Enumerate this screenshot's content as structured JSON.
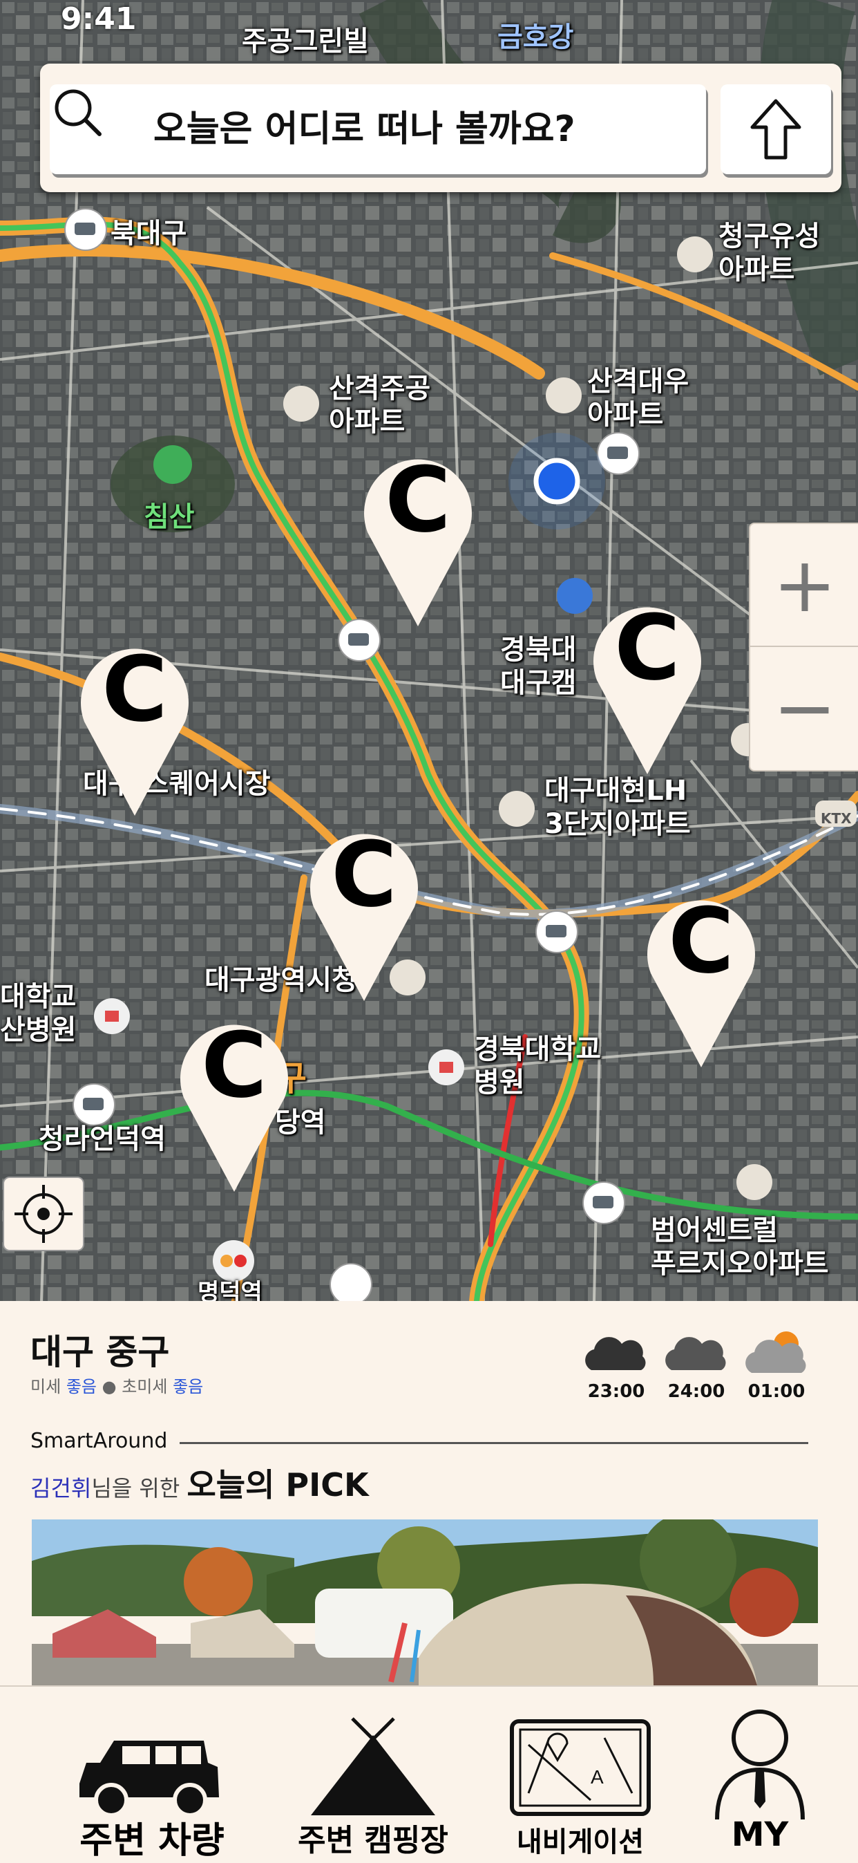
{
  "status_bar": {
    "time": "9:41"
  },
  "search": {
    "placeholder": "오늘은 어디로 떠나 볼까요?"
  },
  "map": {
    "labels": {
      "jugong": "주공그린빌",
      "geumho": "금호강",
      "bukdaegu": "북대구",
      "cheonggu": "청구유성\n아파트",
      "sangyeok_jugong": "산격주공\n아파트",
      "sangyeok_daewoo": "산격대우\n아파트",
      "chimsan": "침산",
      "knu": "경북대\n대구캠",
      "market": "대구 스퀘어시장",
      "lh": "대구대현LH\n3단지아파트",
      "city_hall": "대구광역시청",
      "univ_hospital": "대학교\n산병원",
      "knu_hospital": "경북대학교\n병원",
      "cheongna": "청라언덕역",
      "gu": "구",
      "dangyeok": "당역",
      "beomeo": "범어센트럴\n푸르지오아파트",
      "myeongdeok": "명덕역",
      "ktx": "KTX"
    },
    "pin_letter": "C",
    "zoom_in": "+",
    "zoom_out": "−"
  },
  "panel": {
    "location": "대구 중구",
    "air": {
      "fine_label": "미세",
      "fine_value": "좋음",
      "ultra_label": "초미세",
      "ultra_value": "좋음"
    },
    "weather": [
      {
        "time": "23:00",
        "icon": "cloud-icon"
      },
      {
        "time": "24:00",
        "icon": "cloud-icon"
      },
      {
        "time": "01:00",
        "icon": "sun-cloud-icon"
      }
    ],
    "brand": "SmartAround",
    "user_name": "김건휘",
    "for_text": "님을 위한",
    "pick_title": "오늘의 PICK"
  },
  "nav": {
    "vehicles": "주변 차량",
    "camping": "주변 캠핑장",
    "navigation": "내비게이션",
    "my": "MY"
  },
  "colors": {
    "panel_bg": "#fbf3ea",
    "accent_blue": "#2a56d8",
    "user_blue": "#2a2fb8"
  }
}
